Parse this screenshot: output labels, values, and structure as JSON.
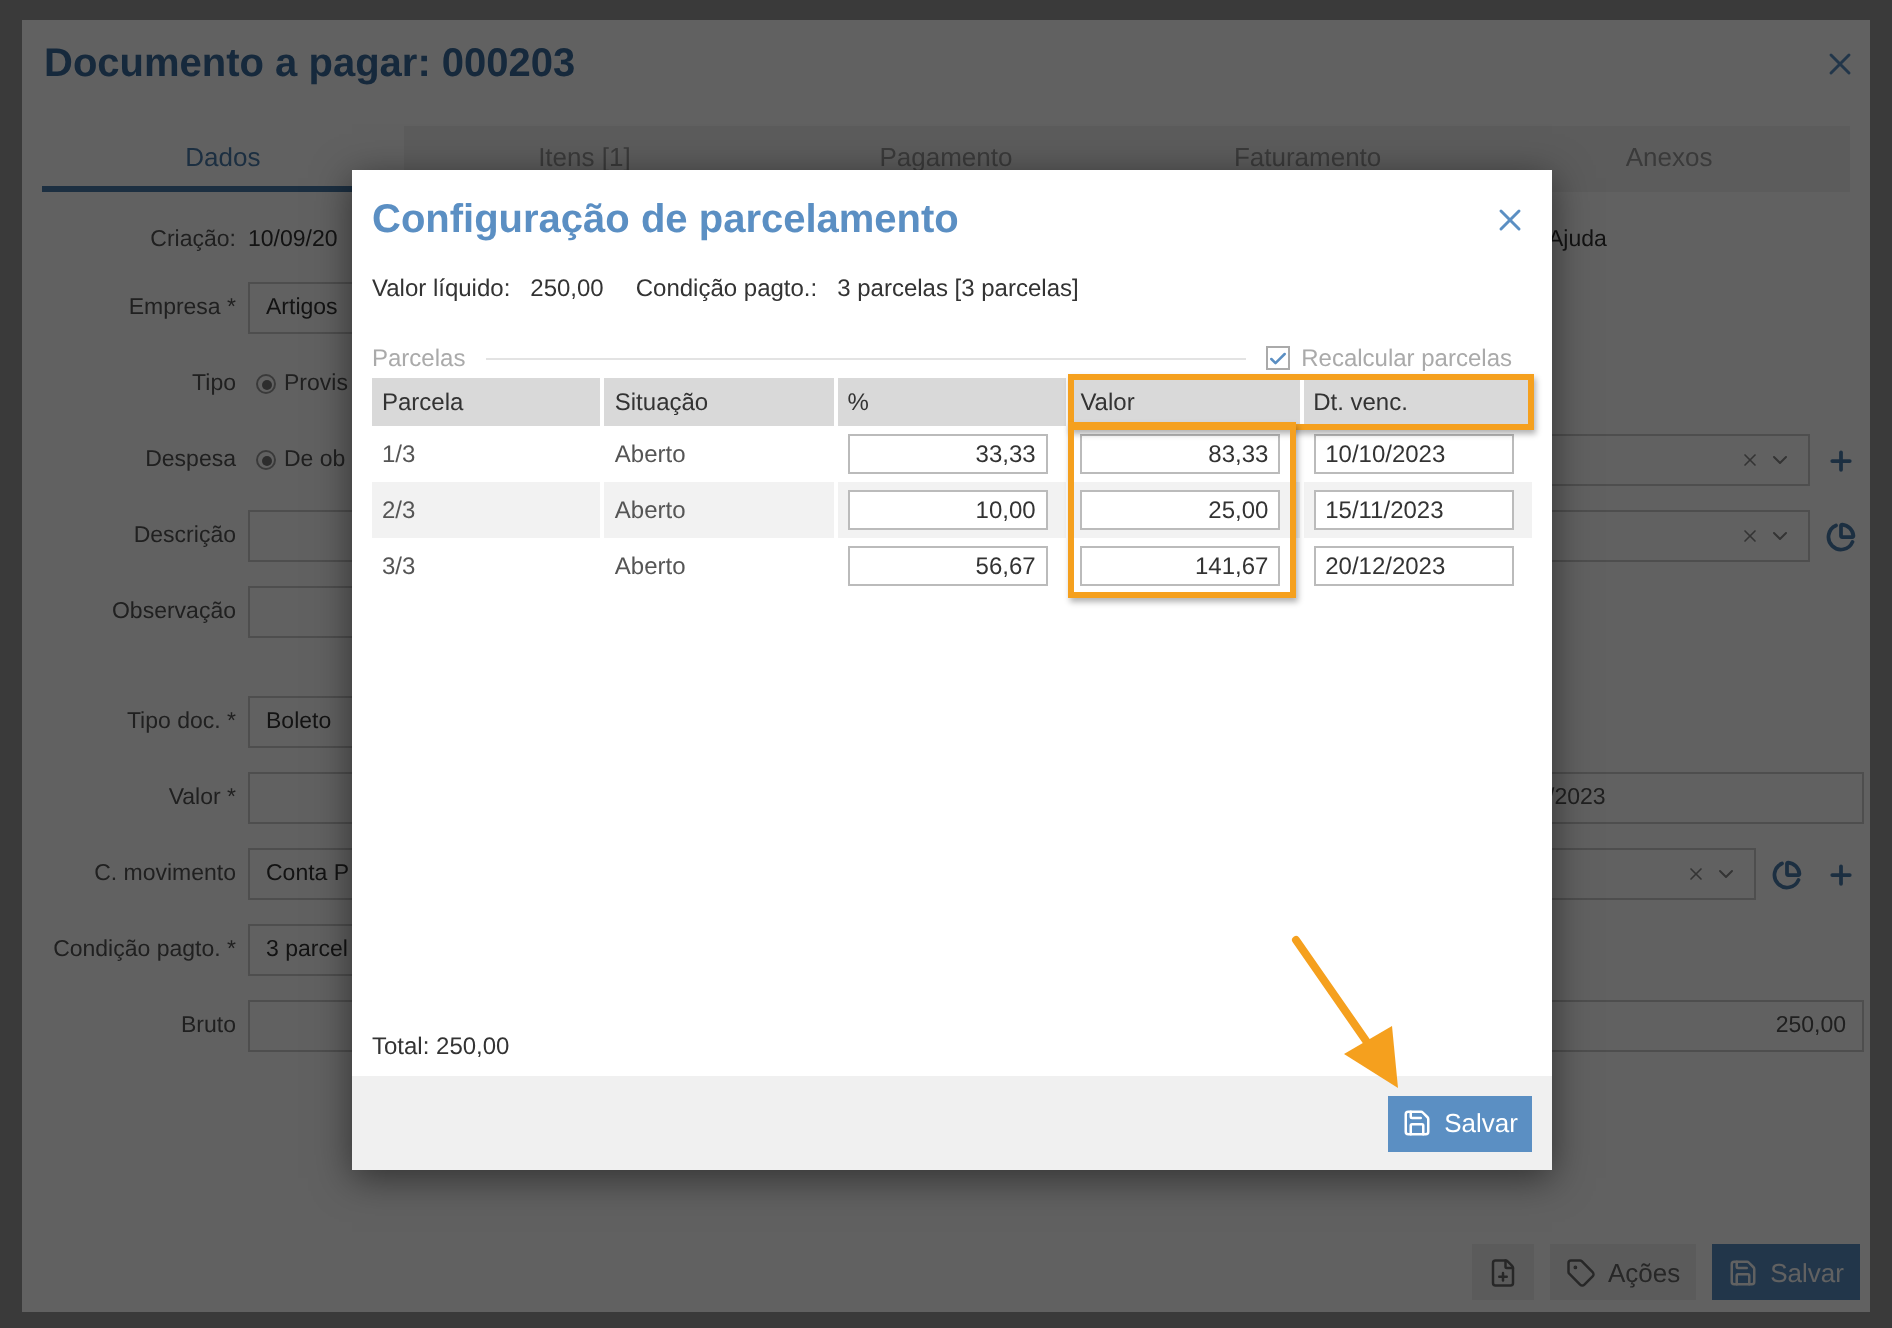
{
  "window": {
    "title": "Documento a pagar: 000203"
  },
  "tabs": [
    {
      "label": "Dados",
      "selected": true
    },
    {
      "label": "Itens [1]",
      "selected": false
    },
    {
      "label": "Pagamento",
      "selected": false
    },
    {
      "label": "Faturamento",
      "selected": false
    },
    {
      "label": "Anexos",
      "selected": false
    }
  ],
  "info": {
    "label": "Criação:",
    "value": "10/09/20",
    "help": "Ajuda"
  },
  "form_sections": [
    [
      {
        "label": "Empresa *",
        "kind": "field",
        "value": "Artigos"
      },
      {
        "label": "Tipo",
        "kind": "radio",
        "value": "Provis",
        "selected": true
      },
      {
        "label": "Despesa",
        "kind": "radio",
        "value": "De ob",
        "selected": true,
        "right": {
          "kind": "select",
          "add": true,
          "chart": false
        }
      },
      {
        "label": "Descrição",
        "kind": "field",
        "right": {
          "kind": "select",
          "add": false,
          "chart": true
        }
      },
      {
        "label": "Observação",
        "kind": "field"
      }
    ],
    [
      {
        "label": "Tipo doc. *",
        "kind": "field",
        "value": "Boleto"
      },
      {
        "label": "Valor *",
        "kind": "field",
        "right": {
          "kind": "field",
          "value": "/2023"
        }
      },
      {
        "label": "C. movimento",
        "kind": "field",
        "value": "Conta P",
        "right": {
          "kind": "select",
          "add": true,
          "chart": true
        }
      },
      {
        "label": "Condição pagto. *",
        "kind": "field",
        "value": "3 parcel"
      },
      {
        "label": "Bruto",
        "kind": "field",
        "right": {
          "kind": "number",
          "value": "250,00"
        }
      }
    ]
  ],
  "actions": [
    {
      "kind": "icon"
    },
    {
      "kind": "menu",
      "label": "Ações"
    },
    {
      "kind": "primary",
      "label": "Salvar"
    }
  ],
  "dialog": {
    "title": "Configuração de parcelamento",
    "summary": [
      {
        "label": "Valor líquido:",
        "value": "250,00"
      },
      {
        "label": "Condição pagto.:",
        "value": "3 parcelas [3 parcelas]"
      }
    ],
    "section": "Parcelas",
    "recalculate": {
      "label": "Recalcular parcelas",
      "checked": true
    },
    "columns": [
      {
        "label": "Parcela",
        "kind": "text",
        "highlighted": false,
        "cells_highlighted": false
      },
      {
        "label": "Situação",
        "kind": "text",
        "highlighted": false,
        "cells_highlighted": false
      },
      {
        "label": "%",
        "kind": "number",
        "highlighted": false,
        "cells_highlighted": false
      },
      {
        "label": "Valor",
        "kind": "number",
        "highlighted": true,
        "cells_highlighted": true
      },
      {
        "label": "Dt. venc.",
        "kind": "date",
        "highlighted": true,
        "cells_highlighted": false
      }
    ],
    "rows": [
      [
        "1/3",
        "Aberto",
        "33,33",
        "83,33",
        "10/10/2023"
      ],
      [
        "2/3",
        "Aberto",
        "10,00",
        "25,00",
        "15/11/2023"
      ],
      [
        "3/3",
        "Aberto",
        "56,67",
        "141,67",
        "20/12/2023"
      ]
    ],
    "total": "Total: 250,00",
    "save": "Salvar"
  }
}
